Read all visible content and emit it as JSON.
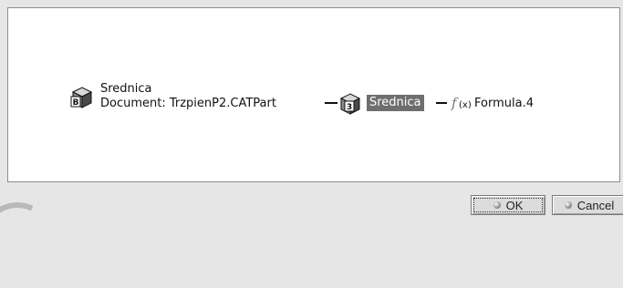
{
  "tree": {
    "root": {
      "icon": "part-document-cube-icon",
      "title": "Srednica",
      "subtitle": "Document: TrzpienP2.CATPart"
    },
    "parameter": {
      "icon": "parameter-cube-icon",
      "label": "Srednica"
    },
    "formula": {
      "icon": "formula-fx-icon",
      "label": "Formula.4"
    }
  },
  "buttons": {
    "ok_label": "OK",
    "cancel_label": "Cancel"
  },
  "colors": {
    "selection_bg": "#6e6e6e",
    "panel_bg": "#ffffff",
    "dialog_bg": "#e6e6e6"
  }
}
